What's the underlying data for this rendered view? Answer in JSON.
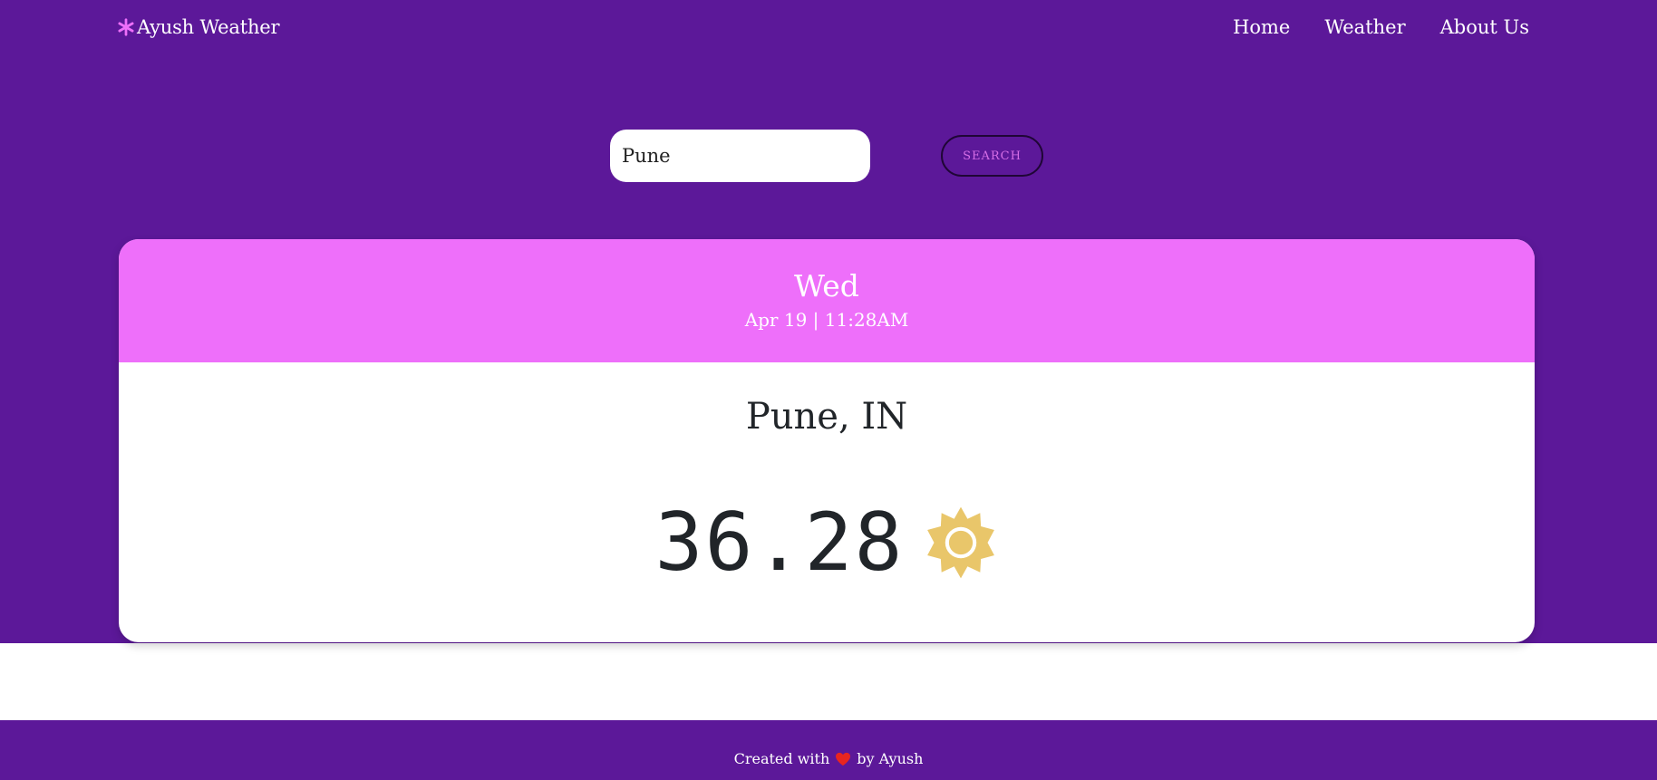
{
  "navbar": {
    "brand": "Ayush Weather",
    "brand_icon": "snowflake-icon",
    "links": [
      "Home",
      "Weather",
      "About Us"
    ]
  },
  "search": {
    "value": "Pune",
    "button_label": "SEARCH"
  },
  "weather": {
    "day": "Wed",
    "datetime": "Apr 19 | 11:28AM",
    "city": "Pune, IN",
    "temperature": "36.28",
    "condition_icon": "sun-icon"
  },
  "footer": {
    "text_before": "Created with",
    "text_after": "by Ayush",
    "icon": "heart-icon"
  },
  "colors": {
    "primary": "#5c1899",
    "accent": "#ee6ffa",
    "sun": "#e9c66a",
    "heart": "#e8251f"
  }
}
